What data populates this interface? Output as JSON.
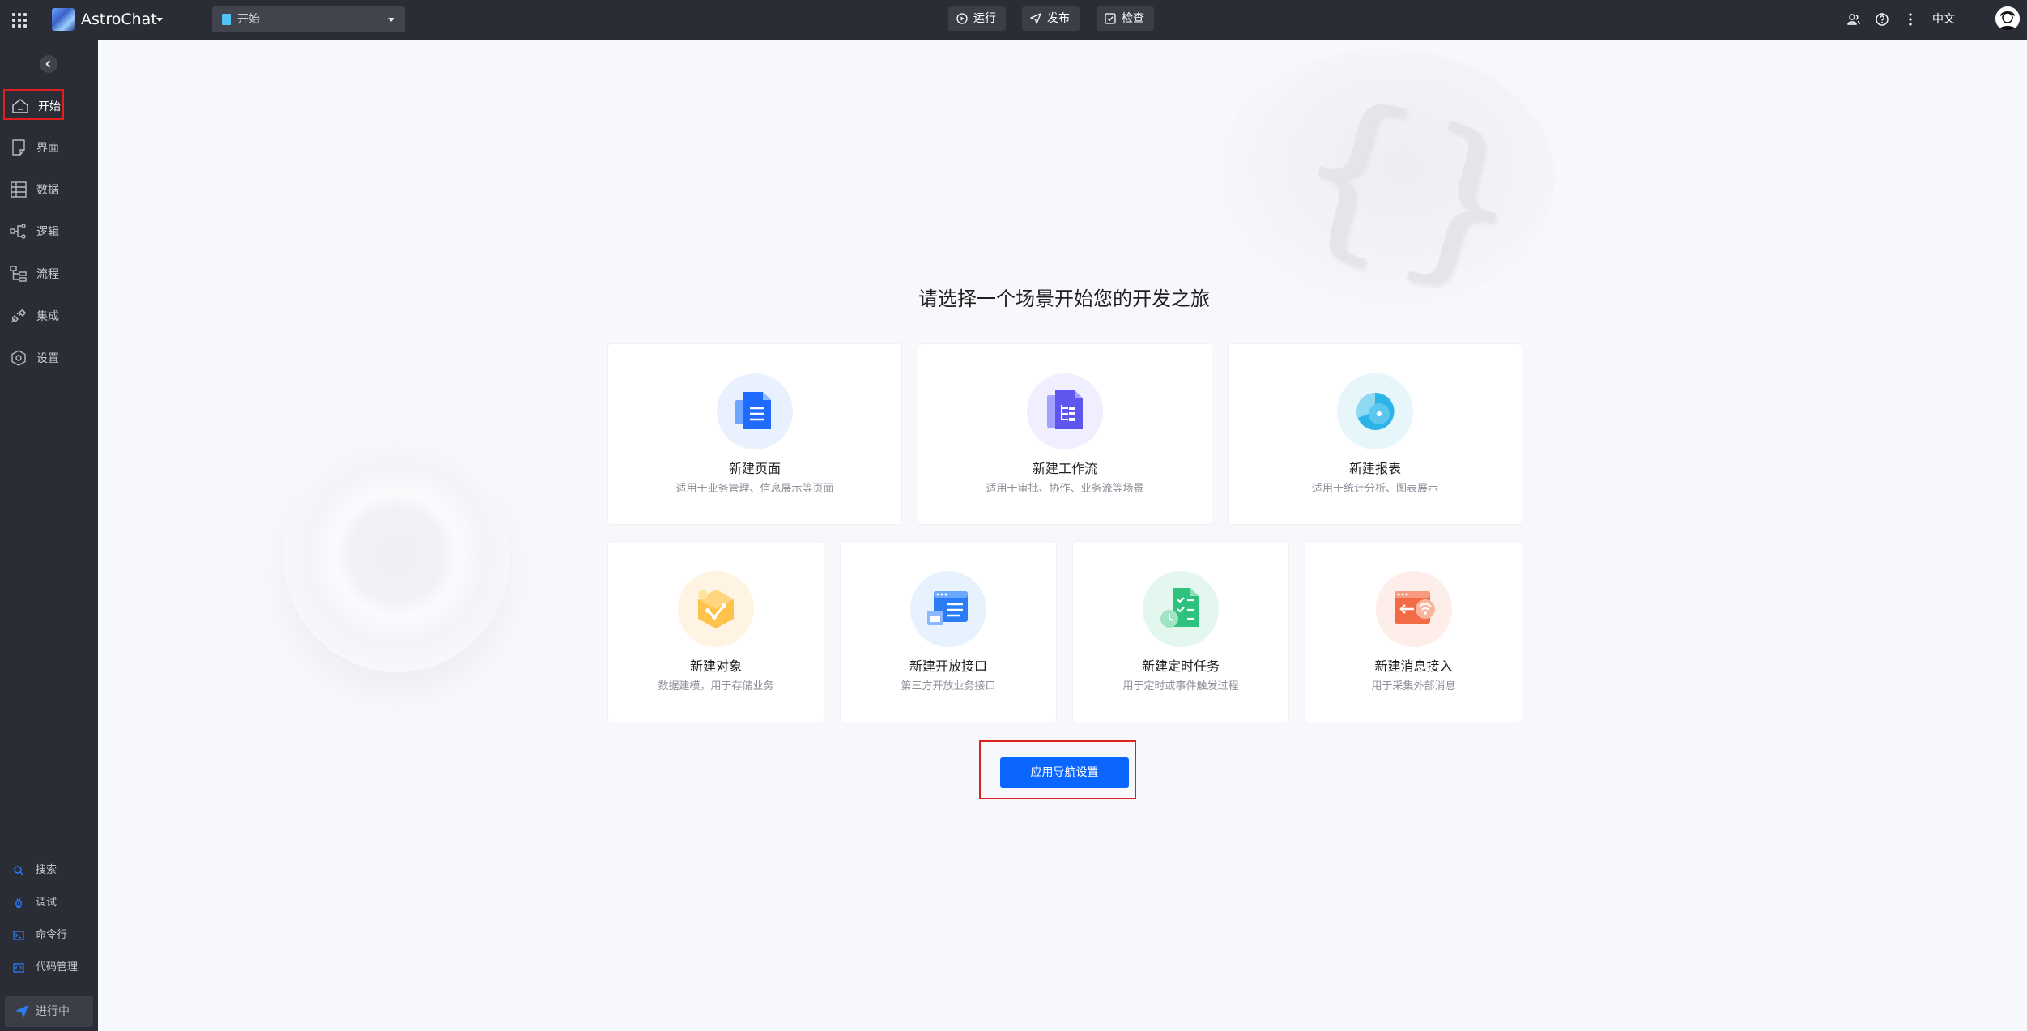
{
  "topbar": {
    "app_name": "AstroChat",
    "page_selector": {
      "value": "开始"
    },
    "actions": [
      {
        "label": "运行",
        "icon": "play-circle-icon"
      },
      {
        "label": "发布",
        "icon": "send-icon"
      },
      {
        "label": "检查",
        "icon": "checkbox-icon"
      }
    ],
    "right_icons": [
      "users-icon",
      "help-icon",
      "more-vertical-icon"
    ],
    "language": "中文"
  },
  "sidebar": {
    "items": [
      {
        "label": "开始",
        "icon": "home-icon",
        "active": true
      },
      {
        "label": "界面",
        "icon": "page-icon"
      },
      {
        "label": "数据",
        "icon": "table-icon"
      },
      {
        "label": "逻辑",
        "icon": "logic-icon"
      },
      {
        "label": "流程",
        "icon": "flow-icon"
      },
      {
        "label": "集成",
        "icon": "integration-icon"
      },
      {
        "label": "设置",
        "icon": "settings-icon"
      }
    ],
    "tools": [
      {
        "label": "搜索",
        "icon": "search-icon"
      },
      {
        "label": "调试",
        "icon": "debug-icon"
      },
      {
        "label": "命令行",
        "icon": "terminal-icon"
      },
      {
        "label": "代码管理",
        "icon": "code-icon"
      }
    ],
    "status": {
      "label": "进行中",
      "icon": "send-icon"
    }
  },
  "main": {
    "title": "请选择一个场景开始您的开发之旅",
    "cards_row1": [
      {
        "title": "新建页面",
        "desc": "适用于业务管理、信息展示等页面",
        "icon": "page-doc-icon"
      },
      {
        "title": "新建工作流",
        "desc": "适用于审批、协作、业务流等场景",
        "icon": "workflow-doc-icon"
      },
      {
        "title": "新建报表",
        "desc": "适用于统计分析、图表展示",
        "icon": "pie-chart-icon"
      }
    ],
    "cards_row2": [
      {
        "title": "新建对象",
        "desc": "数据建模，用于存储业务",
        "icon": "data-object-icon"
      },
      {
        "title": "新建开放接口",
        "desc": "第三方开放业务接口",
        "icon": "api-window-icon"
      },
      {
        "title": "新建定时任务",
        "desc": "用于定时或事件触发过程",
        "icon": "scheduled-task-icon"
      },
      {
        "title": "新建消息接入",
        "desc": "用于采集外部消息",
        "icon": "message-inbound-icon"
      }
    ],
    "nav_button": "应用导航设置"
  },
  "colors": {
    "topbar_bg": "#2b2d36",
    "primary": "#0a66ff",
    "highlight_border": "#e02020",
    "page_bg": "#f7f8fb"
  }
}
